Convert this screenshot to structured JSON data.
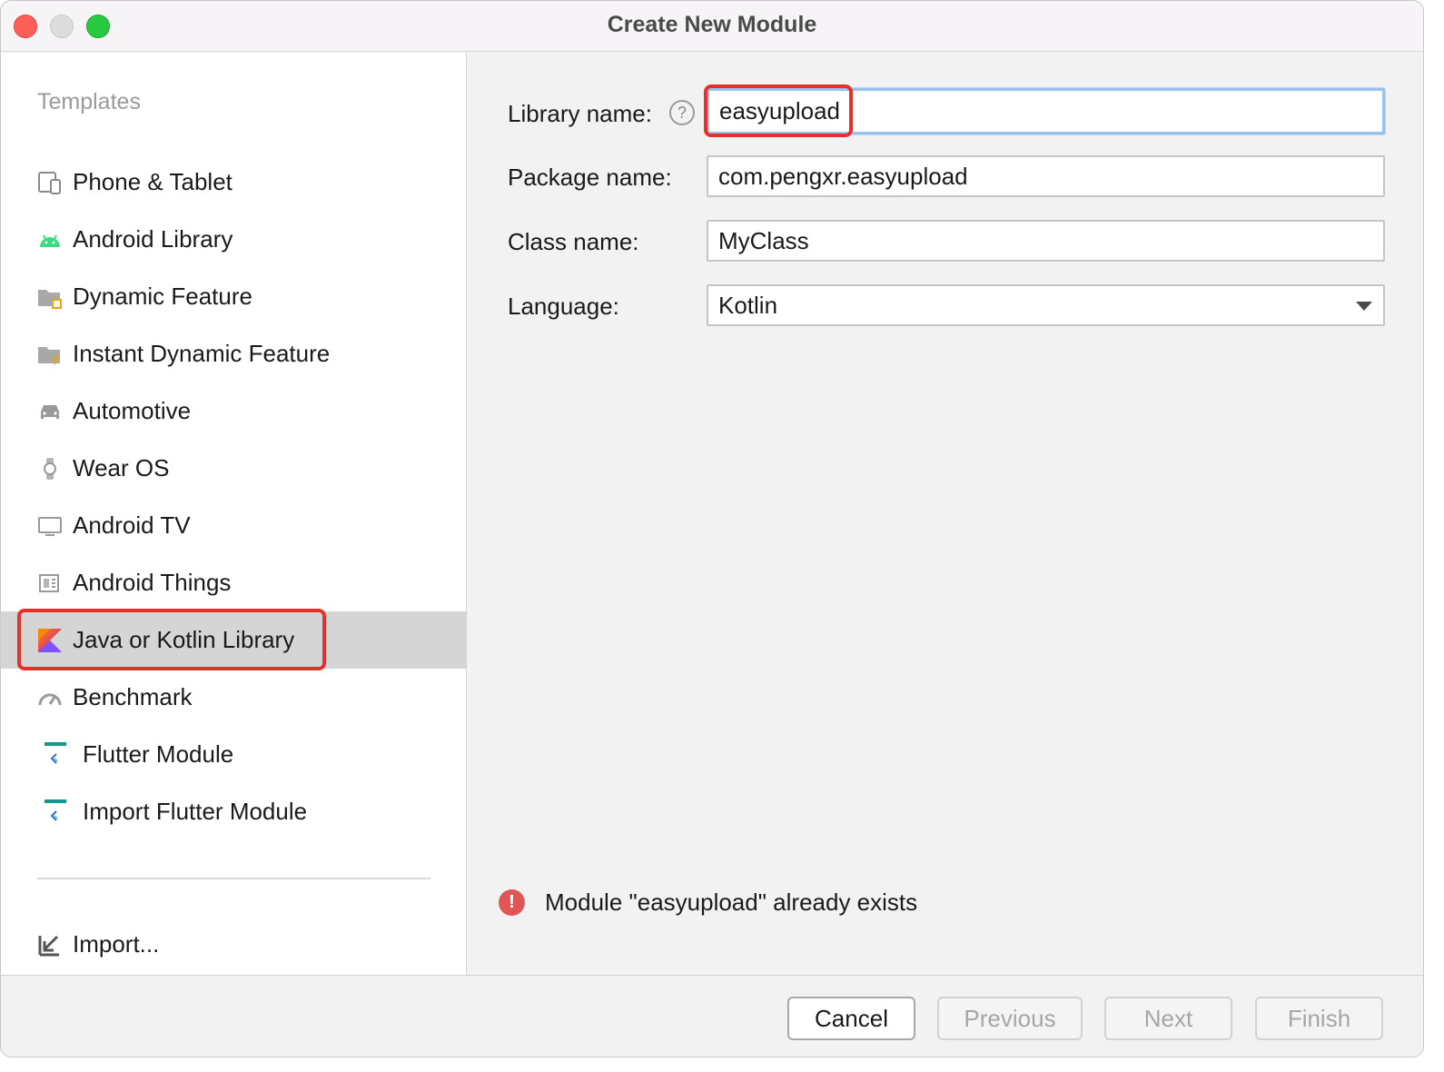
{
  "window": {
    "title": "Create New Module"
  },
  "sidebar": {
    "section_label": "Templates",
    "items": [
      {
        "label": "Phone & Tablet",
        "icon": "phone-tablet-icon"
      },
      {
        "label": "Android Library",
        "icon": "android-icon"
      },
      {
        "label": "Dynamic Feature",
        "icon": "dynamic-feature-folder-icon"
      },
      {
        "label": "Instant Dynamic Feature",
        "icon": "instant-feature-folder-icon"
      },
      {
        "label": "Automotive",
        "icon": "car-icon"
      },
      {
        "label": "Wear OS",
        "icon": "watch-icon"
      },
      {
        "label": "Android TV",
        "icon": "tv-icon"
      },
      {
        "label": "Android Things",
        "icon": "things-board-icon"
      },
      {
        "label": "Java or Kotlin Library",
        "icon": "kotlin-icon",
        "selected": true
      },
      {
        "label": "Benchmark",
        "icon": "gauge-icon"
      },
      {
        "label": "Flutter Module",
        "icon": "flutter-icon"
      },
      {
        "label": "Import Flutter Module",
        "icon": "flutter-icon"
      }
    ],
    "import_label": "Import..."
  },
  "form": {
    "library_name": {
      "label": "Library name:",
      "value": "easyupload",
      "help": "?"
    },
    "package_name": {
      "label": "Package name:",
      "value": "com.pengxr.easyupload"
    },
    "class_name": {
      "label": "Class name:",
      "value": "MyClass"
    },
    "language": {
      "label": "Language:",
      "value": "Kotlin"
    }
  },
  "error": {
    "icon": "!",
    "message": "Module \"easyupload\" already exists"
  },
  "footer": {
    "cancel": "Cancel",
    "previous": "Previous",
    "next": "Next",
    "finish": "Finish"
  },
  "colors": {
    "highlight_red": "#e8302a",
    "selected_bg": "#d5d5d5",
    "focus_blue": "#9ac1ea",
    "error_red": "#e05555"
  }
}
